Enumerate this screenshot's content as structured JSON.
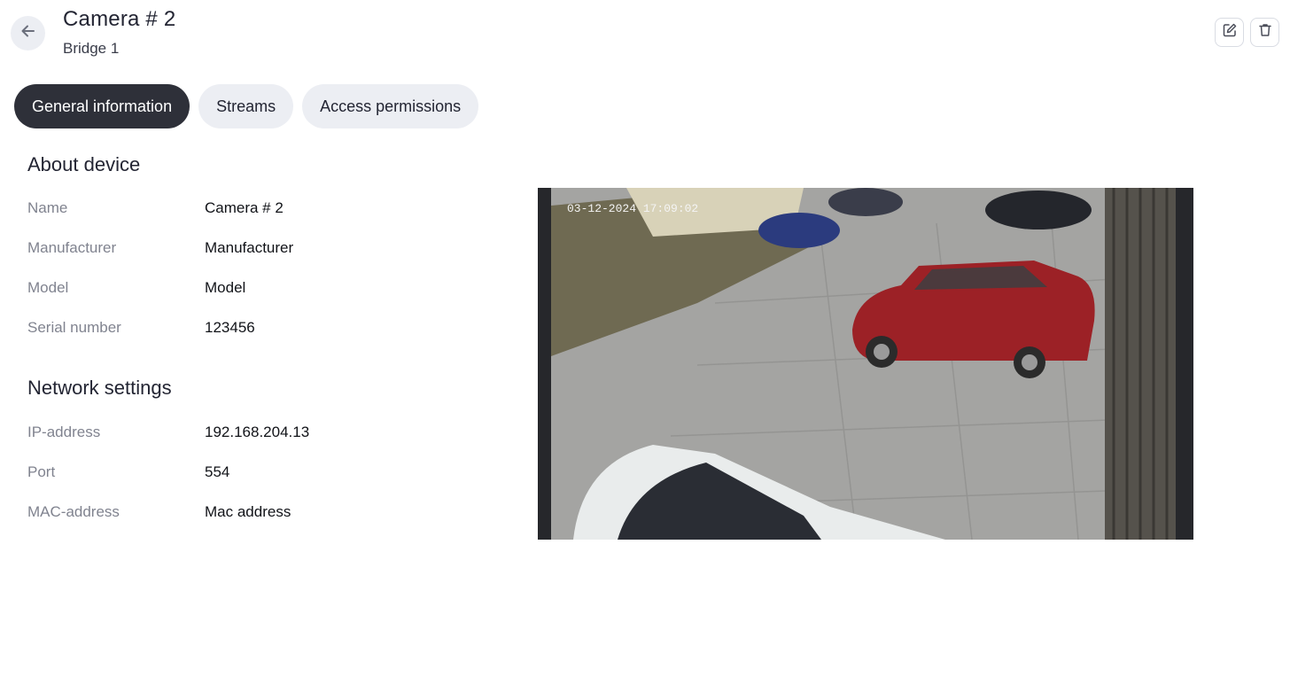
{
  "header": {
    "title": "Camera # 2",
    "subtitle": "Bridge 1",
    "back_icon": "arrow-left-icon",
    "edit_icon": "pencil-square-icon",
    "delete_icon": "trash-icon"
  },
  "tabs": [
    {
      "label": "General information",
      "active": true
    },
    {
      "label": "Streams",
      "active": false
    },
    {
      "label": "Access permissions",
      "active": false
    }
  ],
  "about": {
    "title": "About device",
    "rows": [
      {
        "label": "Name",
        "value": "Camera # 2"
      },
      {
        "label": "Manufacturer",
        "value": "Manufacturer"
      },
      {
        "label": "Model",
        "value": "Model"
      },
      {
        "label": "Serial number",
        "value": "123456"
      }
    ]
  },
  "network": {
    "title": "Network settings",
    "rows": [
      {
        "label": "IP-address",
        "value": "192.168.204.13"
      },
      {
        "label": "Port",
        "value": "554"
      },
      {
        "label": "MAC-address",
        "value": "Mac address"
      }
    ]
  },
  "preview": {
    "timestamp": "03-12-2024 17:09:02"
  },
  "colors": {
    "active_tab_bg": "#2e3039",
    "inactive_tab_bg": "#eceef3",
    "label_text": "#80838f",
    "value_text": "#111318"
  }
}
